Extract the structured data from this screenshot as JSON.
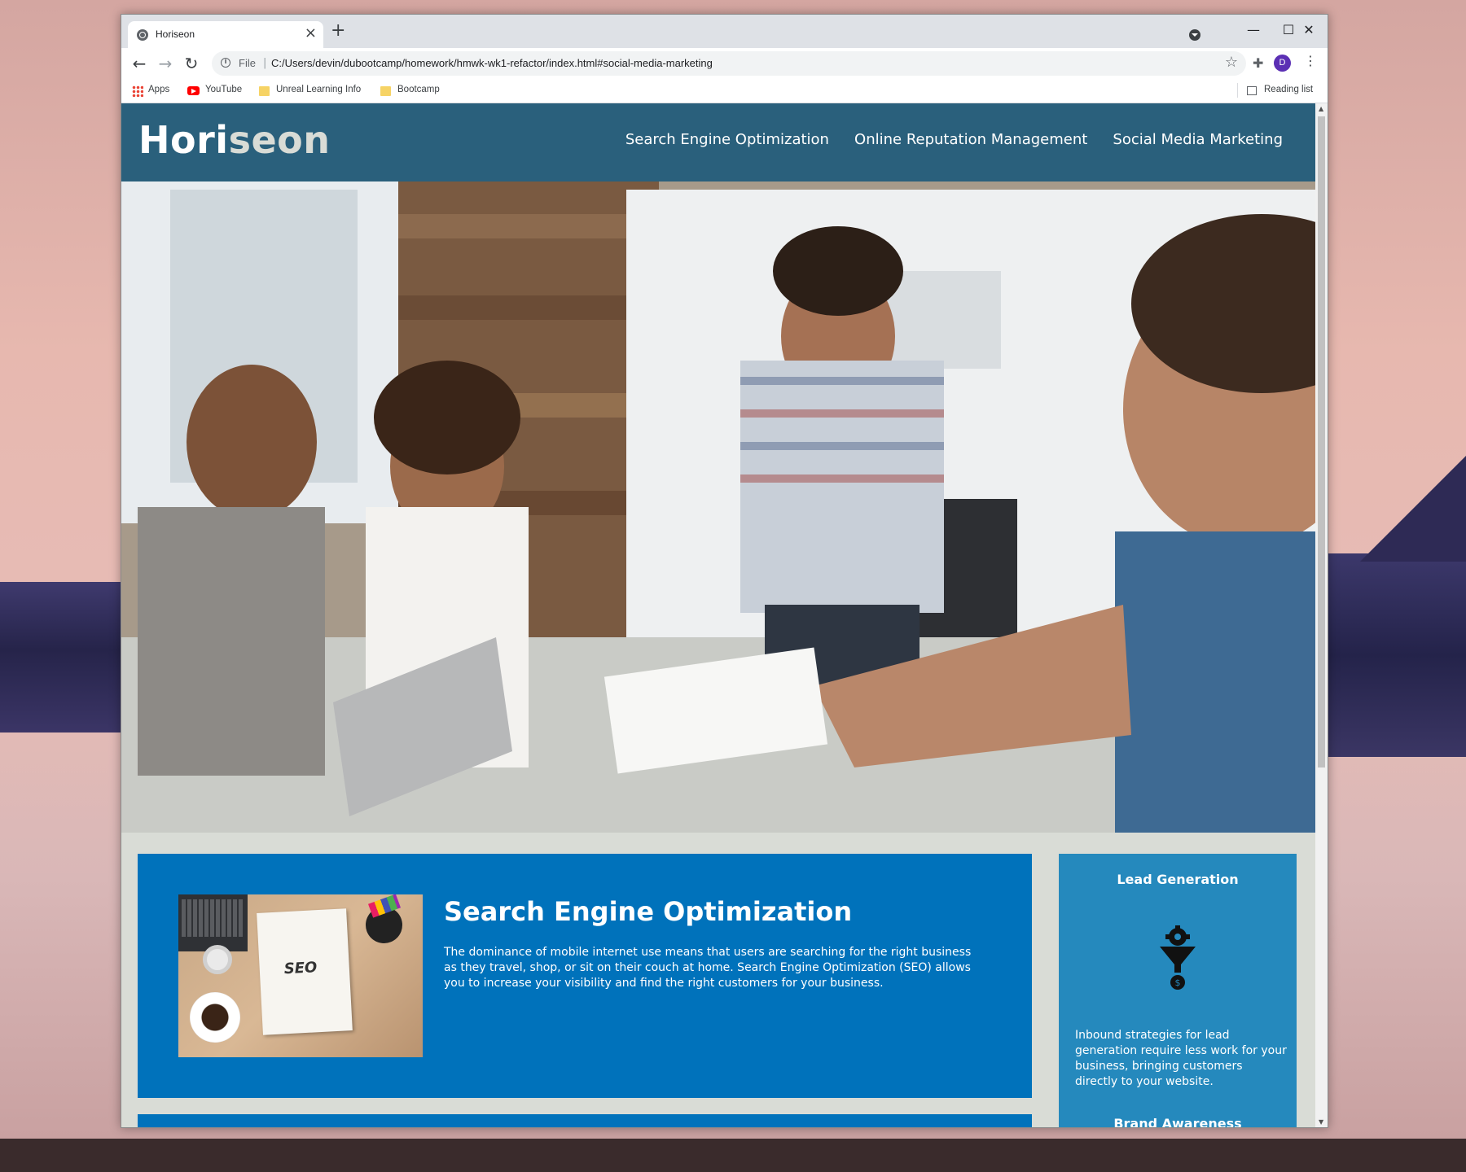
{
  "browser": {
    "tab_title": "Horiseon",
    "new_tab_symbol": "+",
    "close_symbol": "×",
    "url_scheme_label": "File",
    "url": "C:/Users/devin/dubootcamp/homework/hmwk-wk1-refactor/index.html#social-media-marketing",
    "avatar_letter": "D",
    "window_controls": {
      "minimize": "—",
      "maximize": "☐",
      "close": "✕"
    },
    "nav": {
      "back": "←",
      "forward": "→",
      "reload": "↻"
    },
    "bookmarks": [
      {
        "label": "Apps",
        "icon": "apps-grid-icon"
      },
      {
        "label": "YouTube",
        "icon": "youtube-icon"
      },
      {
        "label": "Unreal Learning Info",
        "icon": "folder-icon"
      },
      {
        "label": "Bootcamp",
        "icon": "folder-icon"
      }
    ],
    "reading_list_label": "Reading list"
  },
  "site": {
    "logo_prefix": "Hori",
    "logo_suffix": "seon",
    "nav": [
      "Search Engine Optimization",
      "Online Reputation Management",
      "Social Media Marketing"
    ]
  },
  "content": {
    "seo": {
      "title": "Search Engine Optimization",
      "text": "The dominance of mobile internet use means that users are searching for the right business as they travel, shop, or sit on their couch at home. Search Engine Optimization (SEO) allows you to increase your visibility and find the right customers for your business.",
      "image_label": "SEO"
    }
  },
  "benefits": [
    {
      "title": "Lead Generation",
      "icon": "lead-generation-funnel-icon",
      "text": "Inbound strategies for lead generation require less work for your business, bringing customers directly to your website."
    },
    {
      "title": "Brand Awareness"
    }
  ],
  "colors": {
    "header_bg": "#2a607c",
    "content_bg": "#0072bb",
    "benefit_bg": "#2589bd",
    "page_bg": "#d9dcd6"
  }
}
